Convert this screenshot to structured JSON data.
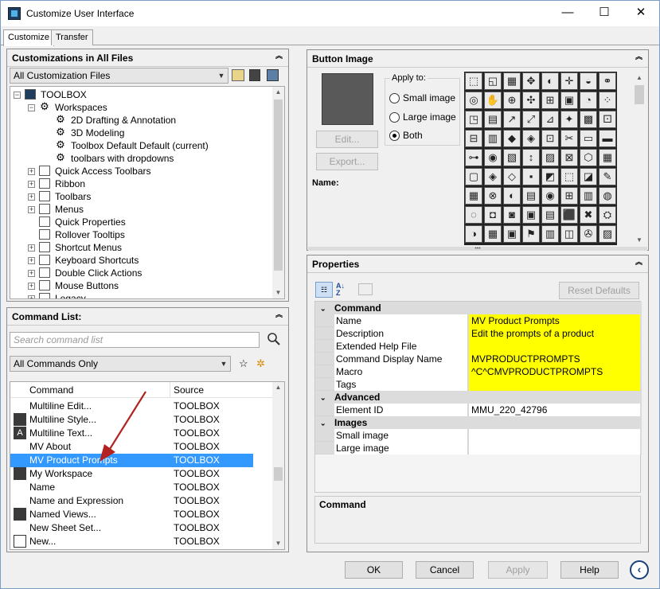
{
  "window": {
    "title": "Customize User Interface",
    "minimize_label": "—",
    "maximize_label": "☐",
    "close_label": "✕"
  },
  "tabs": [
    {
      "label": "Customize"
    },
    {
      "label": "Transfer"
    }
  ],
  "customizations": {
    "header": "Customizations in All Files",
    "file_combo": "All Customization Files",
    "tree": [
      {
        "label": "TOOLBOX",
        "icon": "toolbox-icon"
      },
      {
        "label": "Workspaces",
        "icon": "gear-icon"
      },
      {
        "label": "2D Drafting & Annotation",
        "icon": "gear-icon"
      },
      {
        "label": "3D Modeling",
        "icon": "gear-icon"
      },
      {
        "label": "Toolbox Default Default (current)",
        "icon": "gear-icon"
      },
      {
        "label": "toolbars with dropdowns",
        "icon": "gear-icon"
      },
      {
        "label": "Quick Access Toolbars",
        "icon": "toolbar-icon"
      },
      {
        "label": "Ribbon",
        "icon": "ribbon-icon"
      },
      {
        "label": "Toolbars",
        "icon": "toolbar-icon"
      },
      {
        "label": "Menus",
        "icon": "menu-icon"
      },
      {
        "label": "Quick Properties",
        "icon": "properties-icon"
      },
      {
        "label": "Rollover Tooltips",
        "icon": "tooltip-icon"
      },
      {
        "label": "Shortcut Menus",
        "icon": "shortcut-menu-icon"
      },
      {
        "label": "Keyboard Shortcuts",
        "icon": "keyboard-icon"
      },
      {
        "label": "Double Click Actions",
        "icon": "double-click-icon"
      },
      {
        "label": "Mouse Buttons",
        "icon": "mouse-icon"
      },
      {
        "label": "Legacy",
        "icon": "legacy-icon"
      }
    ]
  },
  "command_list": {
    "header": "Command List:",
    "search_placeholder": "Search command list",
    "filter_combo": "All Commands Only",
    "columns": {
      "command": "Command",
      "source": "Source"
    },
    "rows": [
      {
        "command": "Multiline Edit...",
        "source": "TOOLBOX",
        "icon": ""
      },
      {
        "command": "Multiline Style...",
        "source": "TOOLBOX",
        "icon": "multiline-style-icon"
      },
      {
        "command": "Multiline Text...",
        "source": "TOOLBOX",
        "icon": "text-a-icon"
      },
      {
        "command": "MV About",
        "source": "TOOLBOX",
        "icon": ""
      },
      {
        "command": "MV Product Prompts",
        "source": "TOOLBOX",
        "icon": ""
      },
      {
        "command": "My Workspace",
        "source": "TOOLBOX",
        "icon": "workspace-icon"
      },
      {
        "command": "Name",
        "source": "TOOLBOX",
        "icon": ""
      },
      {
        "command": "Name and Expression",
        "source": "TOOLBOX",
        "icon": ""
      },
      {
        "command": "Named Views...",
        "source": "TOOLBOX",
        "icon": "named-views-icon"
      },
      {
        "command": "New Sheet Set...",
        "source": "TOOLBOX",
        "icon": ""
      },
      {
        "command": "New...",
        "source": "TOOLBOX",
        "icon": "new-file-icon"
      }
    ],
    "selected": "MV Product Prompts"
  },
  "button_image": {
    "header": "Button Image",
    "apply_to_label": "Apply to:",
    "options": [
      "Small image",
      "Large image",
      "Both"
    ],
    "selected_option": "Both",
    "edit_label": "Edit...",
    "export_label": "Export...",
    "name_label": "Name:"
  },
  "properties": {
    "header": "Properties",
    "reset_label": "Reset Defaults",
    "categories": [
      {
        "name": "Command",
        "rows": [
          {
            "name": "Name",
            "value": "MV Product Prompts",
            "highlight": true
          },
          {
            "name": "Description",
            "value": "Edit the prompts of a product",
            "highlight": true
          },
          {
            "name": "Extended Help File",
            "value": "",
            "highlight": true
          },
          {
            "name": "Command Display Name",
            "value": "MVPRODUCTPROMPTS",
            "highlight": true
          },
          {
            "name": "Macro",
            "value": "^C^CMVPRODUCTPROMPTS",
            "highlight": true
          },
          {
            "name": "Tags",
            "value": "",
            "highlight": true
          }
        ]
      },
      {
        "name": "Advanced",
        "rows": [
          {
            "name": "Element ID",
            "value": "MMU_220_42796",
            "highlight": false
          }
        ]
      },
      {
        "name": "Images",
        "rows": [
          {
            "name": "Small image",
            "value": "",
            "highlight": false
          },
          {
            "name": "Large image",
            "value": "",
            "highlight": false
          }
        ]
      }
    ],
    "description_title": "Command"
  },
  "footer": {
    "ok": "OK",
    "cancel": "Cancel",
    "apply": "Apply",
    "help": "Help"
  },
  "colors": {
    "selection": "#3399ff",
    "highlight": "#ffff00",
    "arrow": "#b22222"
  }
}
